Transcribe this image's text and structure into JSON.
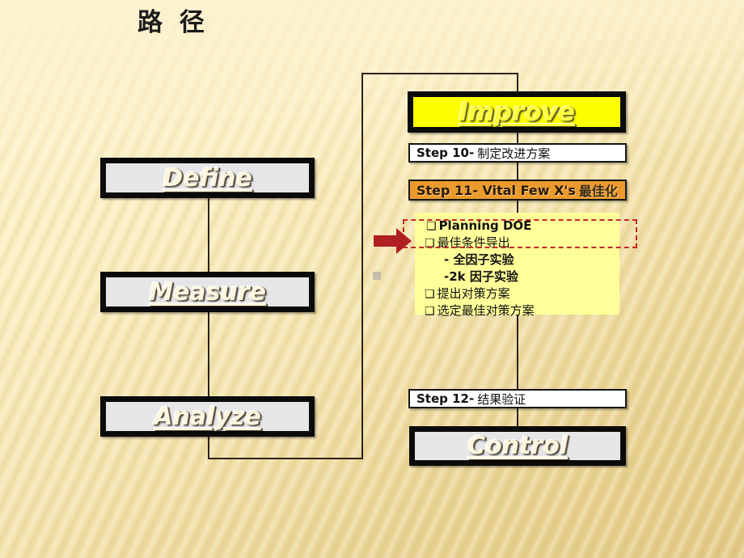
{
  "slide": {
    "title": "路  径",
    "background_color": "#f3e2ab"
  },
  "left_column": {
    "phases": [
      {
        "label": "Define"
      },
      {
        "label": "Measure"
      },
      {
        "label": "Analyze"
      }
    ]
  },
  "right_column": {
    "improve": {
      "label": "Improve",
      "fill": "#ffff00"
    },
    "steps": [
      {
        "lead": "Step 10-",
        "rest": "制定改进方案",
        "fill": "#ffffff"
      },
      {
        "lead": "Step 11- Vital Few X's",
        "rest": "最佳化",
        "fill": "#eb9a2e"
      },
      {
        "lead": "Step 12-",
        "rest": "结果验证",
        "fill": "#ffffff"
      }
    ],
    "detail_panel": {
      "fill": "#ffff99",
      "items": [
        {
          "bullet": "❑",
          "text": "Planning DOE",
          "style": "bold"
        },
        {
          "bullet": "❑",
          "text": "最佳条件导出",
          "style": "normal"
        },
        {
          "bullet": "",
          "text": "- 全因子实验",
          "style": "sub"
        },
        {
          "bullet": "",
          "text": "-2k 因子实验",
          "style": "sub"
        },
        {
          "bullet": "❑",
          "text": "提出对策方案",
          "style": "normal"
        },
        {
          "bullet": "❑",
          "text": "选定最佳对策方案",
          "style": "normal"
        }
      ],
      "highlight_color": "#c62828"
    },
    "control": {
      "label": "Control"
    }
  },
  "arrow": {
    "color": "#b01f22",
    "direction": "right"
  }
}
